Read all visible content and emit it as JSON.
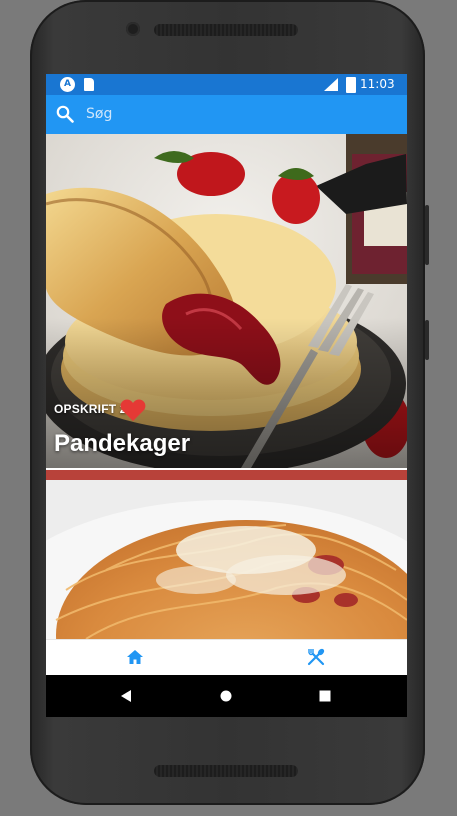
{
  "status_bar": {
    "time": "11:03",
    "app_icon": "A",
    "icons": [
      "app-notification-icon",
      "sd-card-icon",
      "signal-icon",
      "battery-icon"
    ]
  },
  "search": {
    "placeholder": "Søg",
    "value": ""
  },
  "recipes": [
    {
      "category": "OPSKRIFT 2",
      "title": "Pandekager",
      "favorite": true,
      "favorite_icon": "heart-icon",
      "image": "pancakes-photo"
    },
    {
      "category": "",
      "title": "",
      "favorite": false,
      "image": "spaghetti-photo"
    }
  ],
  "bottom_nav": {
    "items": [
      {
        "icon": "home-icon",
        "active": true
      },
      {
        "icon": "fork-spoon-icon",
        "active": false
      }
    ]
  },
  "colors": {
    "status_bar": "#1976d2",
    "app_bar": "#2196f3",
    "accent": "#2196f3",
    "heart": "#e53935"
  }
}
